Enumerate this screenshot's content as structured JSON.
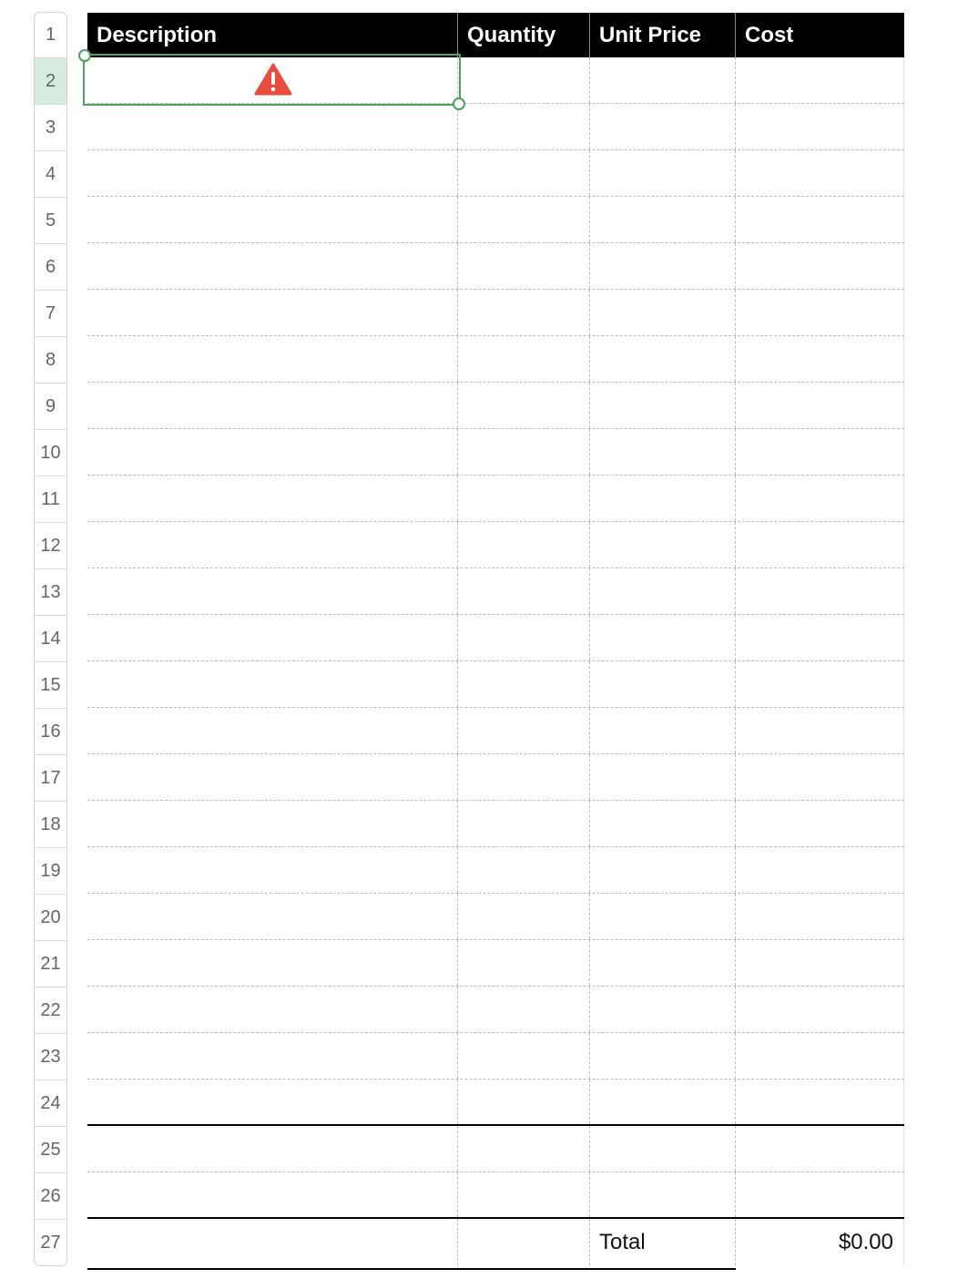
{
  "row_headers": [
    "1",
    "2",
    "3",
    "4",
    "5",
    "6",
    "7",
    "8",
    "9",
    "10",
    "11",
    "12",
    "13",
    "14",
    "15",
    "16",
    "17",
    "18",
    "19",
    "20",
    "21",
    "22",
    "23",
    "24",
    "25",
    "26",
    "27"
  ],
  "selected_row": "2",
  "columns": [
    "Description",
    "Quantity",
    "Unit Price",
    "Cost"
  ],
  "body_rows": 25,
  "footer": {
    "label": "Total",
    "value": "$0.00"
  },
  "selected_cell_icon": "warning-icon",
  "colors": {
    "header_bg": "#000000",
    "header_text": "#ffffff",
    "selection": "#4ca15c",
    "selected_row_header": "#d5ebdd",
    "warning": "#e84c3d"
  }
}
